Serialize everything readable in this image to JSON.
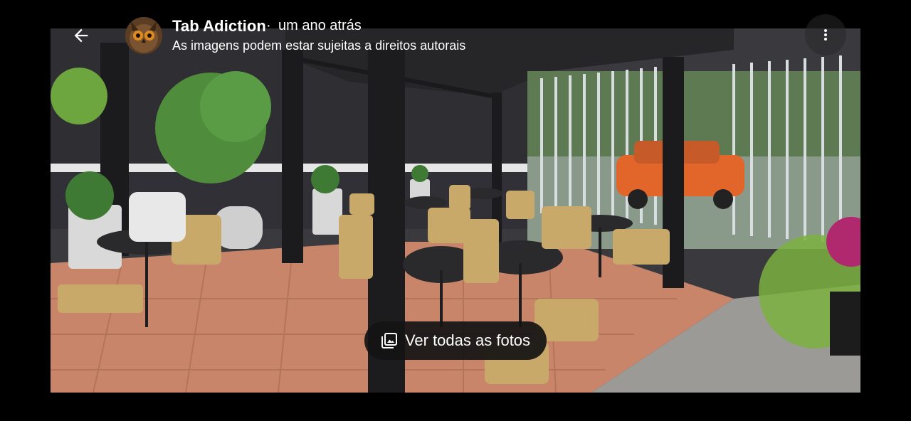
{
  "header": {
    "author": "Tab Adiction",
    "separator": "·",
    "time": "um ano atrás",
    "subtitle": "As imagens podem estar sujeitas a direitos autorais",
    "back_icon": "arrow-back-icon",
    "more_icon": "more-vert-icon"
  },
  "actions": {
    "view_all_label": "Ver todas as fotos",
    "view_all_icon": "photo-library-icon"
  },
  "colors": {
    "background": "#000000",
    "pill": "#141414",
    "text": "#ffffff"
  }
}
